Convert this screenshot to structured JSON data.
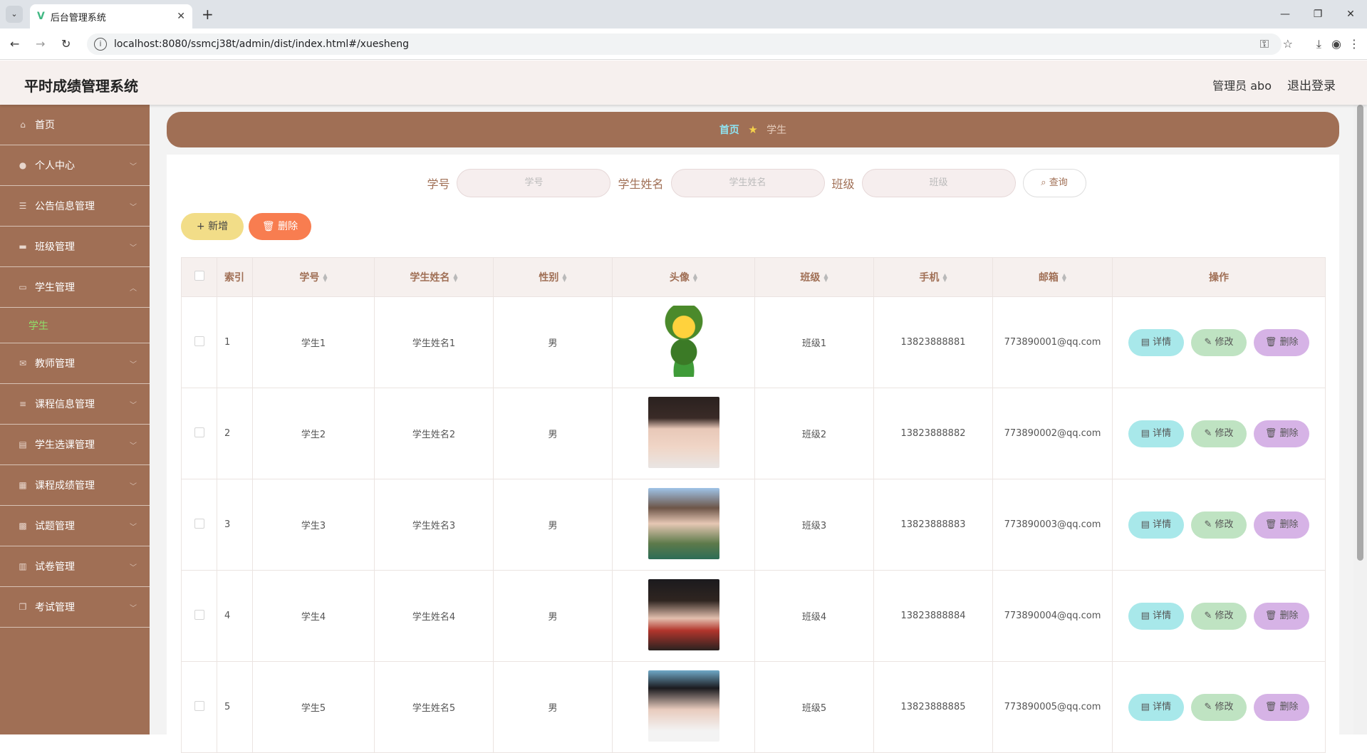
{
  "browser": {
    "tab_title": "后台管理系统",
    "url": "localhost:8080/ssmcj38t/admin/dist/index.html#/xuesheng"
  },
  "header": {
    "app_title": "平时成绩管理系统",
    "user": "管理员 abo",
    "logout": "退出登录"
  },
  "sidebar": {
    "items": [
      {
        "label": "首页",
        "icon": "home-icon"
      },
      {
        "label": "个人中心",
        "icon": "user-icon"
      },
      {
        "label": "公告信息管理",
        "icon": "list-icon"
      },
      {
        "label": "班级管理",
        "icon": "briefcase-icon"
      },
      {
        "label": "学生管理",
        "icon": "chat-icon",
        "expanded": true
      },
      {
        "label": "教师管理",
        "icon": "mail-icon"
      },
      {
        "label": "课程信息管理",
        "icon": "sliders-icon"
      },
      {
        "label": "学生选课管理",
        "icon": "clipboard-icon"
      },
      {
        "label": "课程成绩管理",
        "icon": "calendar-icon"
      },
      {
        "label": "试题管理",
        "icon": "grid-icon"
      },
      {
        "label": "试卷管理",
        "icon": "table-icon"
      },
      {
        "label": "考试管理",
        "icon": "copy-icon"
      }
    ],
    "sub_item": "学生"
  },
  "breadcrumb": {
    "home": "首页",
    "current": "学生"
  },
  "search": {
    "f1_label": "学号",
    "f1_placeholder": "学号",
    "f2_label": "学生姓名",
    "f2_placeholder": "学生姓名",
    "f3_label": "班级",
    "f3_placeholder": "班级",
    "query": "查询"
  },
  "actions": {
    "add": "新增",
    "delete": "删除"
  },
  "table": {
    "headers": {
      "index": "索引",
      "xuehao": "学号",
      "name": "学生姓名",
      "gender": "性别",
      "avatar": "头像",
      "class": "班级",
      "phone": "手机",
      "email": "邮箱",
      "ops": "操作"
    },
    "ops": {
      "detail": "详情",
      "edit": "修改",
      "delete": "删除"
    },
    "rows": [
      {
        "index": "1",
        "xuehao": "学生1",
        "name": "学生姓名1",
        "gender": "男",
        "class": "班级1",
        "phone": "13823888881",
        "email": "773890001@qq.com"
      },
      {
        "index": "2",
        "xuehao": "学生2",
        "name": "学生姓名2",
        "gender": "男",
        "class": "班级2",
        "phone": "13823888882",
        "email": "773890002@qq.com"
      },
      {
        "index": "3",
        "xuehao": "学生3",
        "name": "学生姓名3",
        "gender": "男",
        "class": "班级3",
        "phone": "13823888883",
        "email": "773890003@qq.com"
      },
      {
        "index": "4",
        "xuehao": "学生4",
        "name": "学生姓名4",
        "gender": "男",
        "class": "班级4",
        "phone": "13823888884",
        "email": "773890004@qq.com"
      },
      {
        "index": "5",
        "xuehao": "学生5",
        "name": "学生姓名5",
        "gender": "男",
        "class": "班级5",
        "phone": "13823888885",
        "email": "773890005@qq.com"
      }
    ]
  }
}
